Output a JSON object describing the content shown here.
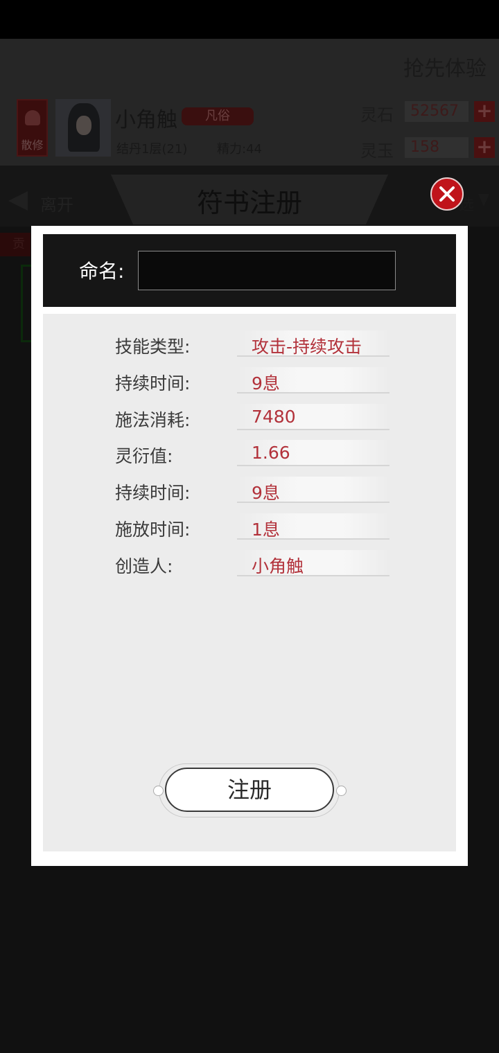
{
  "header": {
    "early_access": "抢先体验",
    "sect": "散修",
    "player_name": "小角触",
    "rank": "凡俗",
    "level": "结丹1层(21)",
    "energy": "精力:44",
    "resources": [
      {
        "label": "灵石",
        "value": "52567"
      },
      {
        "label": "灵玉",
        "value": "158"
      }
    ]
  },
  "nav": {
    "leave": "离开",
    "title": "符书注册",
    "filter": "选",
    "side_tab": "贡"
  },
  "modal": {
    "name_label": "命名:",
    "name_value": "",
    "info": [
      {
        "label": "技能类型:",
        "value": "攻击-持续攻击"
      },
      {
        "label": "持续时间:",
        "value": "9息"
      },
      {
        "label": "施法消耗:",
        "value": "7480"
      },
      {
        "label": "灵衍值:",
        "value": "1.66"
      },
      {
        "label": "持续时间:",
        "value": "9息"
      },
      {
        "label": "施放时间:",
        "value": "1息"
      },
      {
        "label": "创造人:",
        "value": "小角触"
      }
    ],
    "register_button": "注册"
  },
  "colors": {
    "accent_red": "#b2313a",
    "close_red": "#c0141b",
    "overlay": "#111111"
  }
}
